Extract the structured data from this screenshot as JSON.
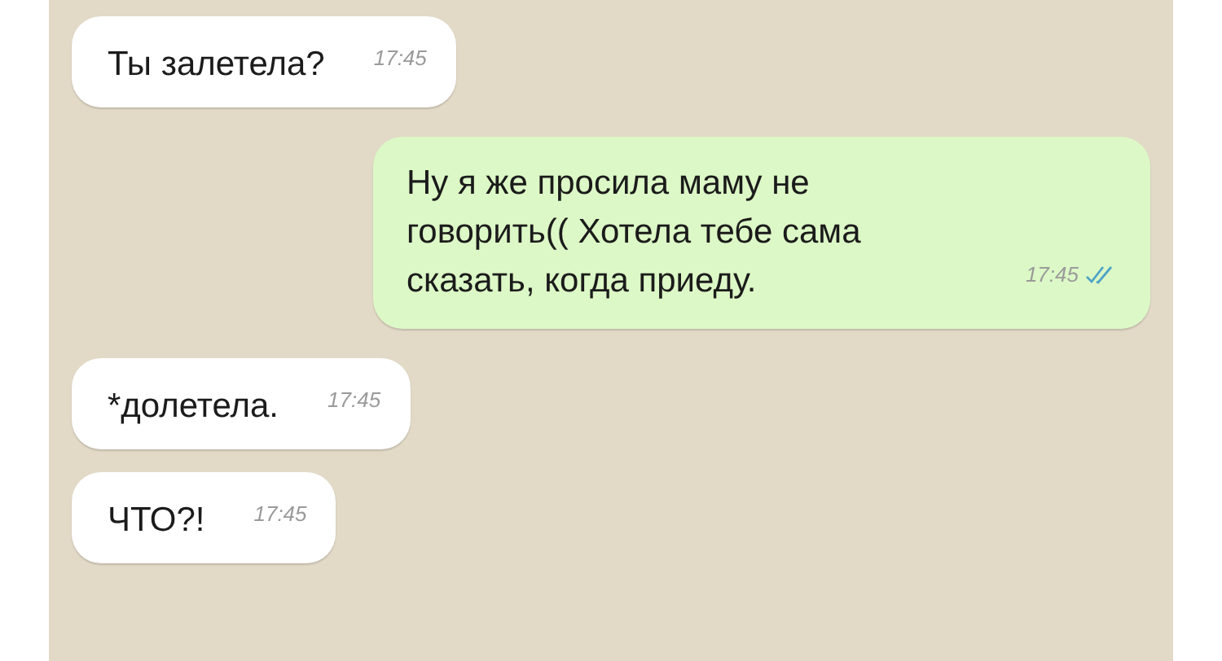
{
  "messages": [
    {
      "kind": "incoming",
      "text": "Ты залетела?",
      "time": "17:45"
    },
    {
      "kind": "outgoing",
      "text": "Ну я же просила маму не говорить(( Хотела тебе сама сказать, когда приеду.",
      "time": "17:45"
    },
    {
      "kind": "incoming",
      "text": "*долетела.",
      "time": "17:45"
    },
    {
      "kind": "incoming",
      "text": "ЧТО?!",
      "time": "17:45"
    }
  ]
}
